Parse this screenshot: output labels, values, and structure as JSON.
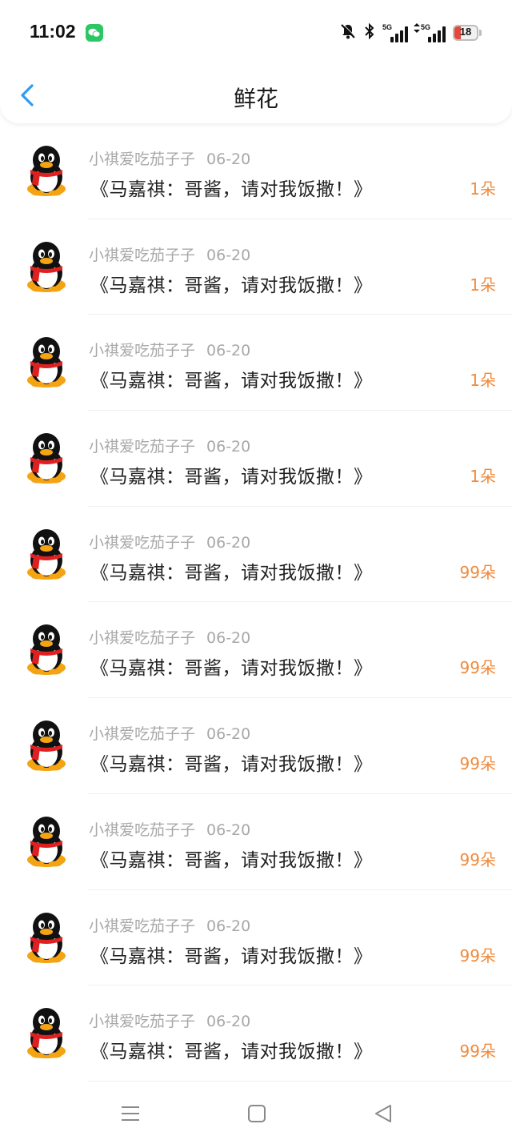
{
  "status": {
    "time": "11:02",
    "net1_label": "5G",
    "net2_label": "5G",
    "battery": "18",
    "colors": {
      "battery_low": "#e3483c",
      "wechat": "#2bc764"
    }
  },
  "header": {
    "title": "鲜花"
  },
  "list": {
    "items": [
      {
        "user": "小祺爱吃茄子子",
        "date": "06-20",
        "message": "《马嘉祺：哥酱，请对我饭撒！》",
        "count": "1朵"
      },
      {
        "user": "小祺爱吃茄子子",
        "date": "06-20",
        "message": "《马嘉祺：哥酱，请对我饭撒！》",
        "count": "1朵"
      },
      {
        "user": "小祺爱吃茄子子",
        "date": "06-20",
        "message": "《马嘉祺：哥酱，请对我饭撒！》",
        "count": "1朵"
      },
      {
        "user": "小祺爱吃茄子子",
        "date": "06-20",
        "message": "《马嘉祺：哥酱，请对我饭撒！》",
        "count": "1朵"
      },
      {
        "user": "小祺爱吃茄子子",
        "date": "06-20",
        "message": "《马嘉祺：哥酱，请对我饭撒！》",
        "count": "99朵"
      },
      {
        "user": "小祺爱吃茄子子",
        "date": "06-20",
        "message": "《马嘉祺：哥酱，请对我饭撒！》",
        "count": "99朵"
      },
      {
        "user": "小祺爱吃茄子子",
        "date": "06-20",
        "message": "《马嘉祺：哥酱，请对我饭撒！》",
        "count": "99朵"
      },
      {
        "user": "小祺爱吃茄子子",
        "date": "06-20",
        "message": "《马嘉祺：哥酱，请对我饭撒！》",
        "count": "99朵"
      },
      {
        "user": "小祺爱吃茄子子",
        "date": "06-20",
        "message": "《马嘉祺：哥酱，请对我饭撒！》",
        "count": "99朵"
      },
      {
        "user": "小祺爱吃茄子子",
        "date": "06-20",
        "message": "《马嘉祺：哥酱，请对我饭撒！》",
        "count": "99朵"
      }
    ]
  },
  "colors": {
    "accent": "#f08a3c",
    "back": "#2e9cf0",
    "meta": "#a8a8a8"
  }
}
